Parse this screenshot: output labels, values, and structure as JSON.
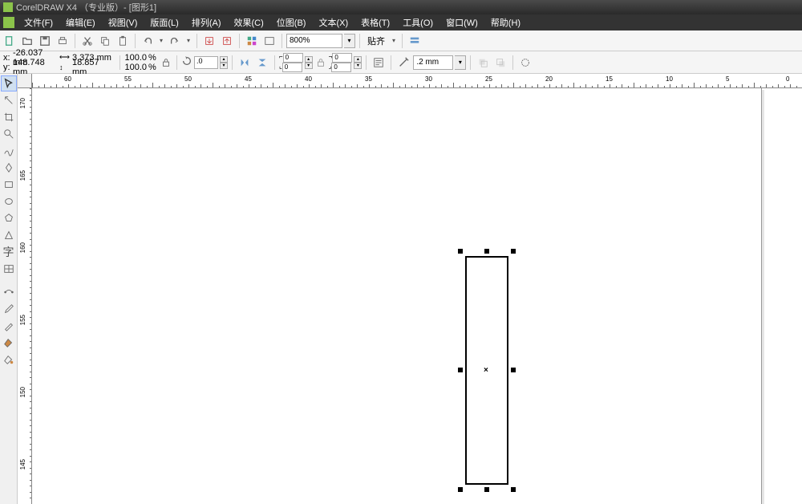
{
  "title": "CorelDRAW X4 （专业版）- [图形1]",
  "menu": {
    "file": "文件(F)",
    "edit": "编辑(E)",
    "view": "视图(V)",
    "layout": "版面(L)",
    "arrange": "排列(A)",
    "effects": "效果(C)",
    "bitmaps": "位图(B)",
    "text": "文本(X)",
    "table": "表格(T)",
    "tools": "工具(O)",
    "window": "窗口(W)",
    "help": "帮助(H)"
  },
  "toolbar": {
    "zoom": "800%",
    "snap_label": "贴齐"
  },
  "properties": {
    "x_label": "x:",
    "x_value": "-26.037 mm",
    "y_label": "y:",
    "y_value": "148.748 mm",
    "width_value": "3.373 mm",
    "height_value": "18.857 mm",
    "scale_x": "100.0",
    "scale_y": "100.0",
    "scale_unit": "%",
    "rotation": ".0",
    "corner1": "0",
    "corner2": "0",
    "corner3": "0",
    "corner4": "0",
    "outline_width": ".2 mm"
  },
  "ruler_h": [
    "60",
    "55",
    "50",
    "45",
    "40",
    "35",
    "30",
    "25",
    "20",
    "15",
    "10",
    "5",
    "0"
  ],
  "ruler_v": [
    "170",
    "165",
    "160",
    "155",
    "150",
    "145"
  ]
}
